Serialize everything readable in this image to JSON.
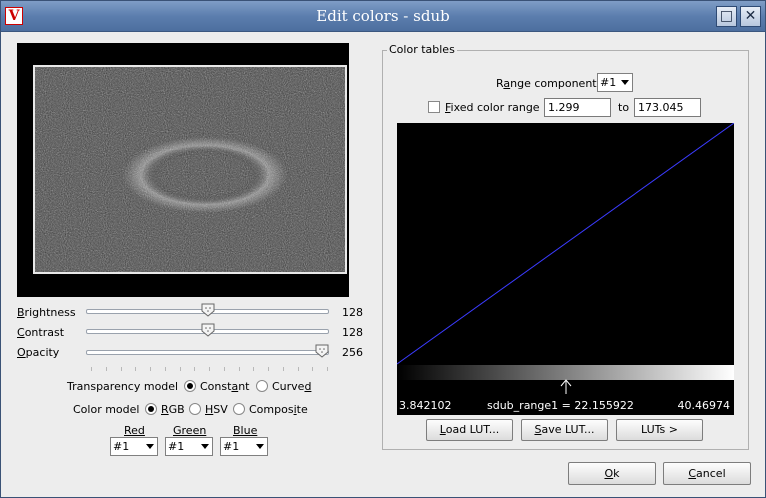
{
  "window": {
    "title": "Edit colors - sdub",
    "app_icon_letter": "V",
    "restore_glyph": "□",
    "close_glyph": "✕"
  },
  "image_view": {
    "subject": "sdub"
  },
  "sliders": [
    {
      "id": "brightness",
      "label": "Brightness",
      "value": "128",
      "fraction": 0.5
    },
    {
      "id": "contrast",
      "label": "Contrast",
      "value": "128",
      "fraction": 0.5
    },
    {
      "id": "opacity",
      "label": "Opacity",
      "value": "256",
      "fraction": 1.0
    }
  ],
  "transparency": {
    "label": "Transparency model",
    "options": [
      "Constant",
      "Curved"
    ],
    "selected": "Constant"
  },
  "color_model": {
    "label": "Color model",
    "options": [
      "RGB",
      "HSV",
      "Composite"
    ],
    "selected": "RGB"
  },
  "rgb_mapping": {
    "red": {
      "label": "Red",
      "value": "#1"
    },
    "green": {
      "label": "Green",
      "value": "#1"
    },
    "blue": {
      "label": "Blue",
      "value": "#1"
    }
  },
  "color_tables": {
    "group_title": "Color tables",
    "range_component_label": "Range component",
    "range_component_value": "#1",
    "fixed_range_label": "Fixed color range",
    "fixed_range_checked": false,
    "range_min": "1.299",
    "range_to_label": "to",
    "range_max": "173.045",
    "lut": {
      "line_color": "#3b3bff",
      "min_label": "3.842102",
      "max_label": "40.46974",
      "probe_label": "sdub_range1 = 22.155922",
      "probe_fraction": 0.5
    },
    "buttons": {
      "load": "Load LUT...",
      "save": "Save LUT...",
      "luts": "LUTs >"
    }
  },
  "footer": {
    "ok": "Ok",
    "cancel": "Cancel"
  }
}
